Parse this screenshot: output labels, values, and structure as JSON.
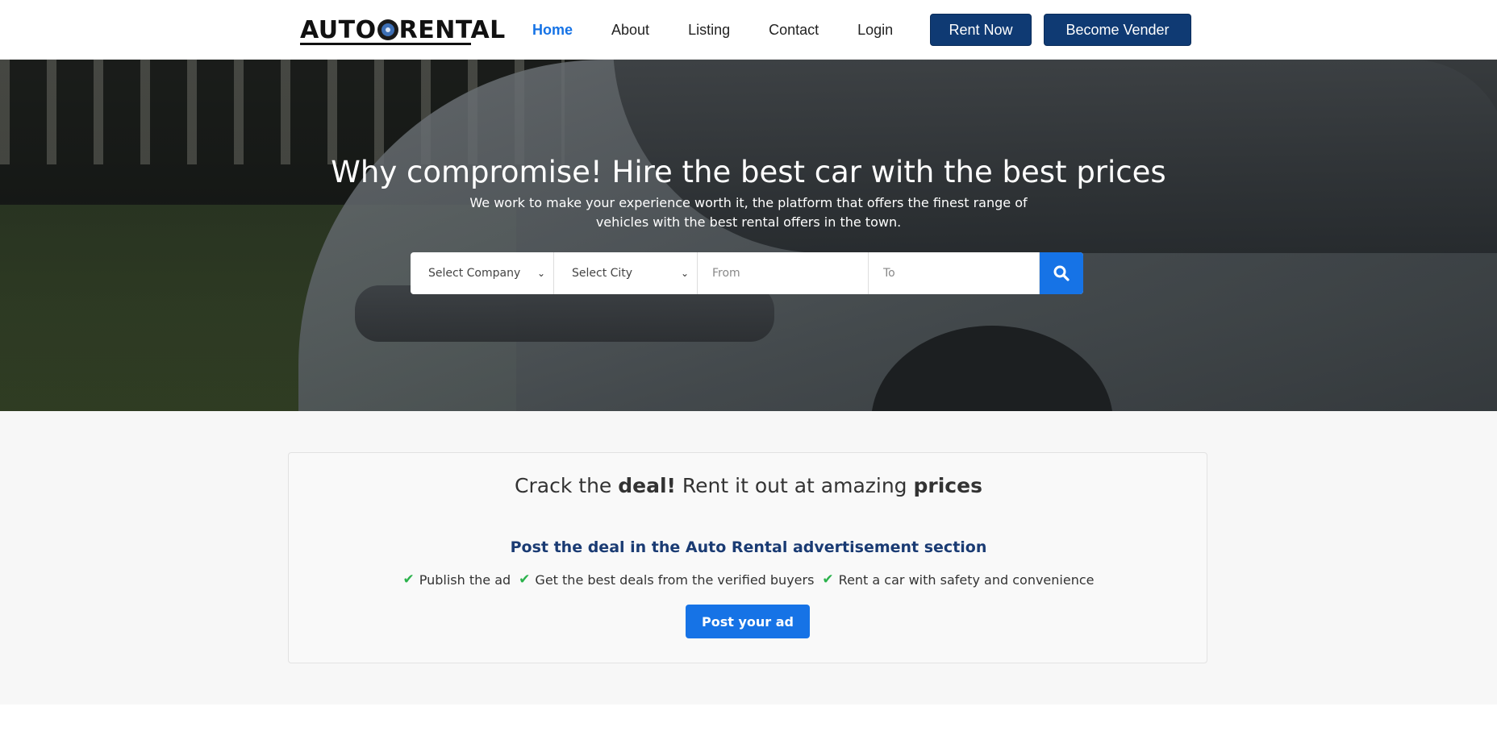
{
  "header": {
    "logo_text_left": "AUTO",
    "logo_text_right": "RENTAL",
    "nav": [
      {
        "label": "Home",
        "active": true
      },
      {
        "label": "About"
      },
      {
        "label": "Listing"
      },
      {
        "label": "Contact"
      },
      {
        "label": "Login"
      }
    ],
    "rent_now": "Rent Now",
    "become_vendor": "Become Vender"
  },
  "hero": {
    "title": "Why compromise! Hire the best car with the best prices",
    "subtitle": "We work to make your experience worth it, the platform that offers the finest range of vehicles with the best rental offers in the town.",
    "search": {
      "company": "Select Company",
      "city": "Select City",
      "from_placeholder": "From",
      "to_placeholder": "To"
    }
  },
  "deal": {
    "heading_1": "Crack the ",
    "heading_b1": "deal!",
    "heading_2": " Rent it out at amazing ",
    "heading_b2": "prices",
    "sub_1": "Post the deal in the ",
    "sub_brand": "Auto Rental",
    "sub_2": " advertisement section",
    "features": [
      "Publish the ad",
      "Get the best deals from the verified buyers",
      "Rent a car with safety and convenience"
    ],
    "cta": "Post your ad"
  },
  "colors": {
    "accent": "#1673e6",
    "navy": "#0f3a73",
    "check": "#2bb24c"
  }
}
